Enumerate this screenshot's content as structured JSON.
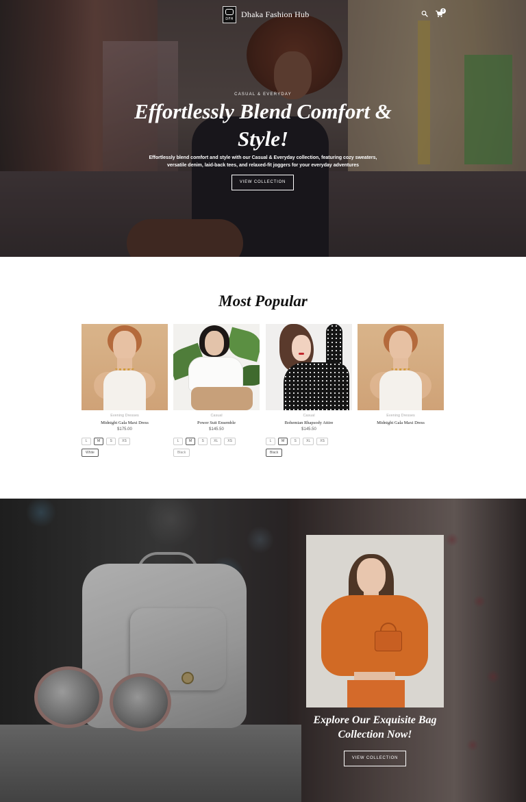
{
  "header": {
    "logo_text": "DFH",
    "brand": "Dhaka Fashion Hub",
    "cart_count": "0",
    "icons": [
      "search-icon",
      "cart-icon"
    ]
  },
  "hero": {
    "eyebrow": "Casual & Everyday",
    "title": "Effortlessly Blend Comfort & Style!",
    "subtitle": "Effortlessly blend comfort and style with our Casual & Everyday collection, featuring cozy sweaters, versatile denim, laid-back tees, and relaxed-fit joggers for your everyday adventures",
    "button": "View Collection"
  },
  "popular": {
    "title": "Most Popular",
    "products": [
      {
        "category": "Evening Dresses",
        "name": "Midnight Gala Maxi Dress",
        "price": "$175.00",
        "sizes": [
          "L",
          "M",
          "S",
          "XS"
        ],
        "selected_size": "M",
        "color": "White"
      },
      {
        "category": "Casual",
        "name": "Power Suit Ensemble",
        "price": "$145.50",
        "sizes": [
          "L",
          "M",
          "S",
          "XL",
          "XS"
        ],
        "selected_size": "M",
        "color": "Black"
      },
      {
        "category": "Casual",
        "name": "Bohemian Rhapsody Attire",
        "price": "$145.50",
        "sizes": [
          "L",
          "M",
          "S",
          "XL",
          "XS"
        ],
        "selected_size": "M",
        "color": "Black"
      },
      {
        "category": "Evening Dresses",
        "name": "Midnight Gala Maxi Dress",
        "price": "",
        "sizes": [],
        "selected_size": "",
        "color": ""
      }
    ]
  },
  "promo": {
    "title": "Explore Our Exquisite Bag Collection Now!",
    "button": "View Collection"
  }
}
